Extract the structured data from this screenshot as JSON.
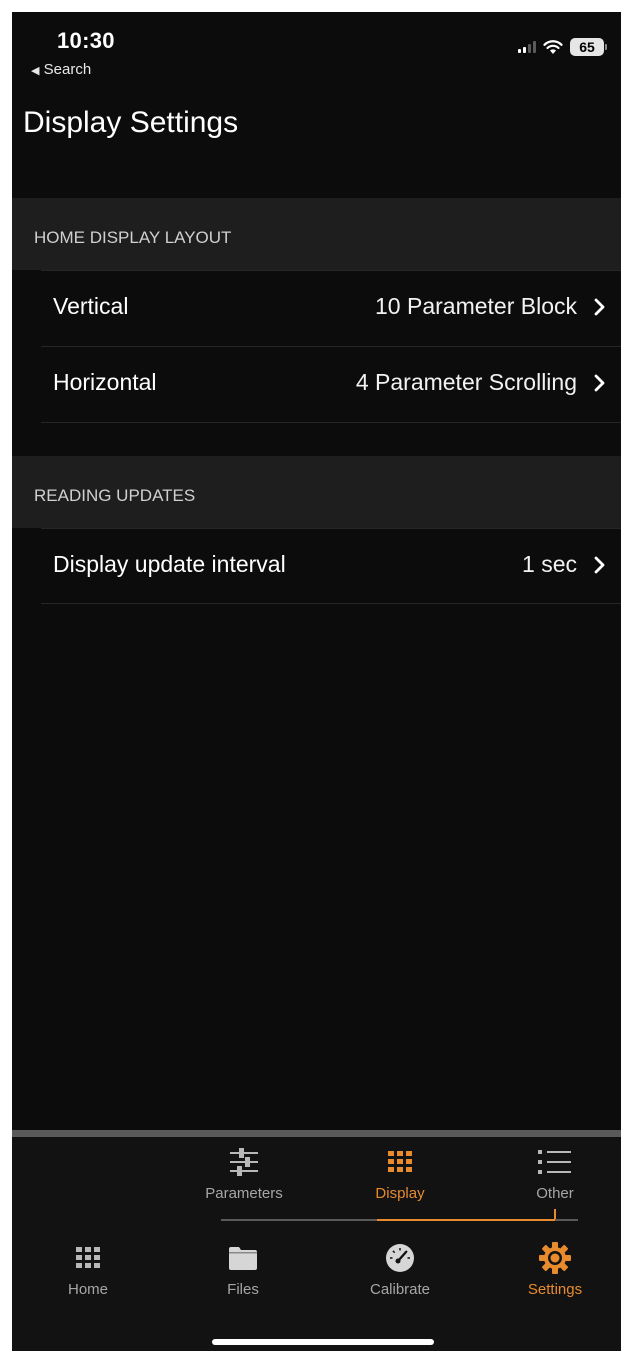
{
  "status": {
    "time": "10:30",
    "back_label": "Search",
    "battery": "65"
  },
  "page": {
    "title": "Display Settings"
  },
  "sections": [
    {
      "header": "HOME DISPLAY LAYOUT",
      "rows": [
        {
          "label": "Vertical",
          "value": "10 Parameter Block"
        },
        {
          "label": "Horizontal",
          "value": "4 Parameter Scrolling"
        }
      ]
    },
    {
      "header": "READING UPDATES",
      "rows": [
        {
          "label": "Display update interval",
          "value": "1 sec"
        }
      ]
    }
  ],
  "subtabs": [
    {
      "label": "Parameters",
      "icon": "sliders-icon",
      "active": false
    },
    {
      "label": "Display",
      "icon": "grid-icon",
      "active": true
    },
    {
      "label": "Other",
      "icon": "list-icon",
      "active": false
    }
  ],
  "tabs": [
    {
      "label": "Home",
      "icon": "grid-icon",
      "active": false
    },
    {
      "label": "Files",
      "icon": "folder-icon",
      "active": false
    },
    {
      "label": "Calibrate",
      "icon": "gauge-icon",
      "active": false
    },
    {
      "label": "Settings",
      "icon": "gear-icon",
      "active": true
    }
  ],
  "colors": {
    "accent": "#e88a2e",
    "background": "#0c0c0c",
    "section_header": "#1e1e1e",
    "inactive": "#a6a6a6"
  }
}
